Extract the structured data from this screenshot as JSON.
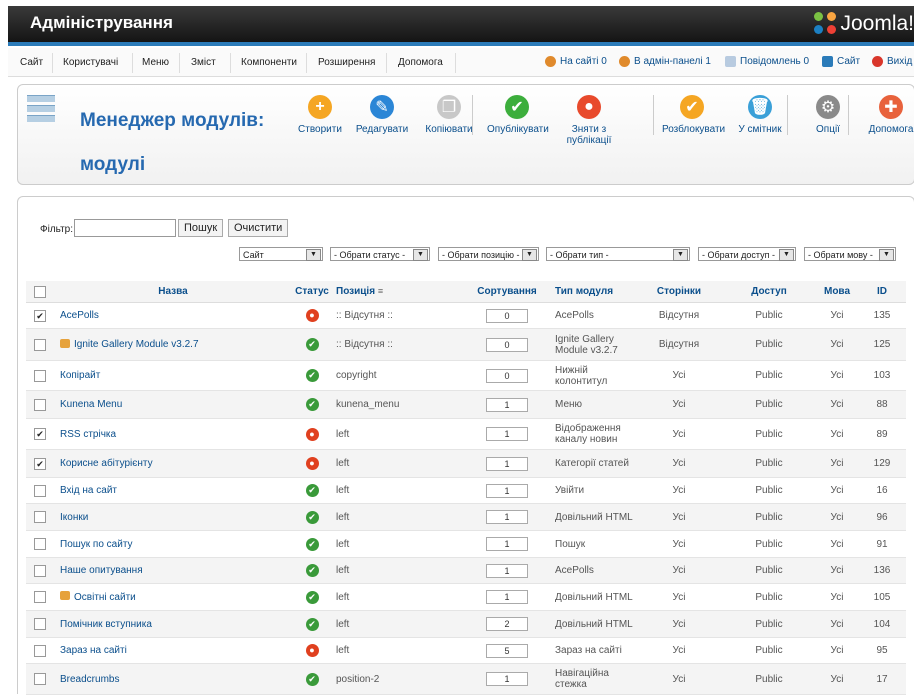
{
  "header": {
    "title": "Адміністрування",
    "logo_text": "Joomla!"
  },
  "menu": {
    "items": [
      "Сайт",
      "Користувачі",
      "Меню",
      "Зміст",
      "Компоненти",
      "Розширення",
      "Допомога"
    ],
    "status": [
      {
        "label": "На сайті 0",
        "icon": "users-icon",
        "color": "#e08a2c"
      },
      {
        "label": "В адмін-панелі 1",
        "icon": "admin-users-icon",
        "color": "#e08a2c"
      },
      {
        "label": "Повідомлень 0",
        "icon": "messages-icon",
        "color": "#7a9cc6"
      },
      {
        "label": "Сайт",
        "icon": "site-icon",
        "color": "#2b7bb9"
      },
      {
        "label": "Вихід",
        "icon": "logout-icon",
        "color": "#d9362b"
      }
    ]
  },
  "toolbar": {
    "title": "Менеджер модулів: модулі",
    "buttons": [
      {
        "label": "Створити",
        "icon": "new-icon",
        "color": "#f5a623",
        "glyph": "+"
      },
      {
        "label": "Редагувати",
        "icon": "edit-icon",
        "color": "#2b86d6",
        "glyph": "✎"
      },
      {
        "label": "Копіювати",
        "icon": "copy-icon",
        "color": "#c8c8c8",
        "glyph": "❐"
      },
      {
        "label": "Опублікувати",
        "icon": "publish-icon",
        "color": "#3cae3c",
        "glyph": "✔"
      },
      {
        "label": "Зняти з публікації",
        "icon": "unpublish-icon",
        "color": "#e84a2c",
        "glyph": "●"
      },
      {
        "label": "Розблокувати",
        "icon": "checkin-icon",
        "color": "#f5a623",
        "glyph": "✔"
      },
      {
        "label": "У смітник",
        "icon": "trash-icon",
        "color": "#3aa0d8",
        "glyph": "🗑"
      },
      {
        "label": "Опції",
        "icon": "options-icon",
        "color": "#8a8a8a",
        "glyph": "⚙"
      },
      {
        "label": "Допомога",
        "icon": "help-icon",
        "color": "#e8623c",
        "glyph": "✚"
      }
    ]
  },
  "filter": {
    "label": "Фільтр:",
    "value": "",
    "search_label": "Пошук",
    "clear_label": "Очистити",
    "selects": [
      "Сайт",
      "- Обрати статус -",
      "- Обрати позицію -",
      "- Обрати тип -",
      "- Обрати доступ -",
      "- Обрати мову -"
    ]
  },
  "table": {
    "headers": [
      "Назва",
      "Статус",
      "Позиція",
      "Сортування",
      "Тип модуля",
      "Сторінки",
      "Доступ",
      "Мова",
      "ID"
    ],
    "rows": [
      {
        "checked": true,
        "locked": false,
        "name": "AcePolls",
        "published": false,
        "position": ":: Відсутня ::",
        "order": "0",
        "type": "AcePolls",
        "pages": "Відсутня",
        "access": "Public",
        "lang": "Усі",
        "id": "135"
      },
      {
        "checked": false,
        "locked": true,
        "name": "Ignite Gallery Module v3.2.7",
        "published": true,
        "position": ":: Відсутня ::",
        "order": "0",
        "type": "Ignite Gallery Module v3.2.7",
        "pages": "Відсутня",
        "access": "Public",
        "lang": "Усі",
        "id": "125"
      },
      {
        "checked": false,
        "locked": false,
        "name": "Копірайт",
        "published": true,
        "position": "copyright",
        "order": "0",
        "type": "Нижній колонтитул",
        "pages": "Усі",
        "access": "Public",
        "lang": "Усі",
        "id": "103"
      },
      {
        "checked": false,
        "locked": false,
        "name": "Kunena Menu",
        "published": true,
        "position": "kunena_menu",
        "order": "1",
        "type": "Меню",
        "pages": "Усі",
        "access": "Public",
        "lang": "Усі",
        "id": "88"
      },
      {
        "checked": true,
        "locked": false,
        "name": "RSS стрічка",
        "published": false,
        "position": "left",
        "order": "1",
        "type": "Відображення каналу новин",
        "pages": "Усі",
        "access": "Public",
        "lang": "Усі",
        "id": "89"
      },
      {
        "checked": true,
        "locked": false,
        "name": "Корисне абітурієнту",
        "published": false,
        "position": "left",
        "order": "1",
        "type": "Категорії статей",
        "pages": "Усі",
        "access": "Public",
        "lang": "Усі",
        "id": "129"
      },
      {
        "checked": false,
        "locked": false,
        "name": "Вхід на сайт",
        "published": true,
        "position": "left",
        "order": "1",
        "type": "Увійти",
        "pages": "Усі",
        "access": "Public",
        "lang": "Усі",
        "id": "16"
      },
      {
        "checked": false,
        "locked": false,
        "name": "Іконки",
        "published": true,
        "position": "left",
        "order": "1",
        "type": "Довільний HTML",
        "pages": "Усі",
        "access": "Public",
        "lang": "Усі",
        "id": "96"
      },
      {
        "checked": false,
        "locked": false,
        "name": "Пошук по сайту",
        "published": true,
        "position": "left",
        "order": "1",
        "type": "Пошук",
        "pages": "Усі",
        "access": "Public",
        "lang": "Усі",
        "id": "91"
      },
      {
        "checked": false,
        "locked": false,
        "name": "Наше опитування",
        "published": true,
        "position": "left",
        "order": "1",
        "type": "AcePolls",
        "pages": "Усі",
        "access": "Public",
        "lang": "Усі",
        "id": "136"
      },
      {
        "checked": false,
        "locked": true,
        "name": "Освітні сайти",
        "published": true,
        "position": "left",
        "order": "1",
        "type": "Довільний HTML",
        "pages": "Усі",
        "access": "Public",
        "lang": "Усі",
        "id": "105"
      },
      {
        "checked": false,
        "locked": false,
        "name": "Помічник вступника",
        "published": true,
        "position": "left",
        "order": "2",
        "type": "Довільний HTML",
        "pages": "Усі",
        "access": "Public",
        "lang": "Усі",
        "id": "104"
      },
      {
        "checked": false,
        "locked": false,
        "name": "Зараз на сайті",
        "published": false,
        "position": "left",
        "order": "5",
        "type": "Зараз на сайті",
        "pages": "Усі",
        "access": "Public",
        "lang": "Усі",
        "id": "95"
      },
      {
        "checked": false,
        "locked": false,
        "name": "Breadcrumbs",
        "published": true,
        "position": "position-2",
        "order": "1",
        "type": "Навігаційна стежка",
        "pages": "Усі",
        "access": "Public",
        "lang": "Усі",
        "id": "17"
      }
    ]
  },
  "colors": {
    "published": "#3a9a3a",
    "unpublished": "#e0401f",
    "link": "#0b4f8c",
    "accent": "#2669b0"
  }
}
